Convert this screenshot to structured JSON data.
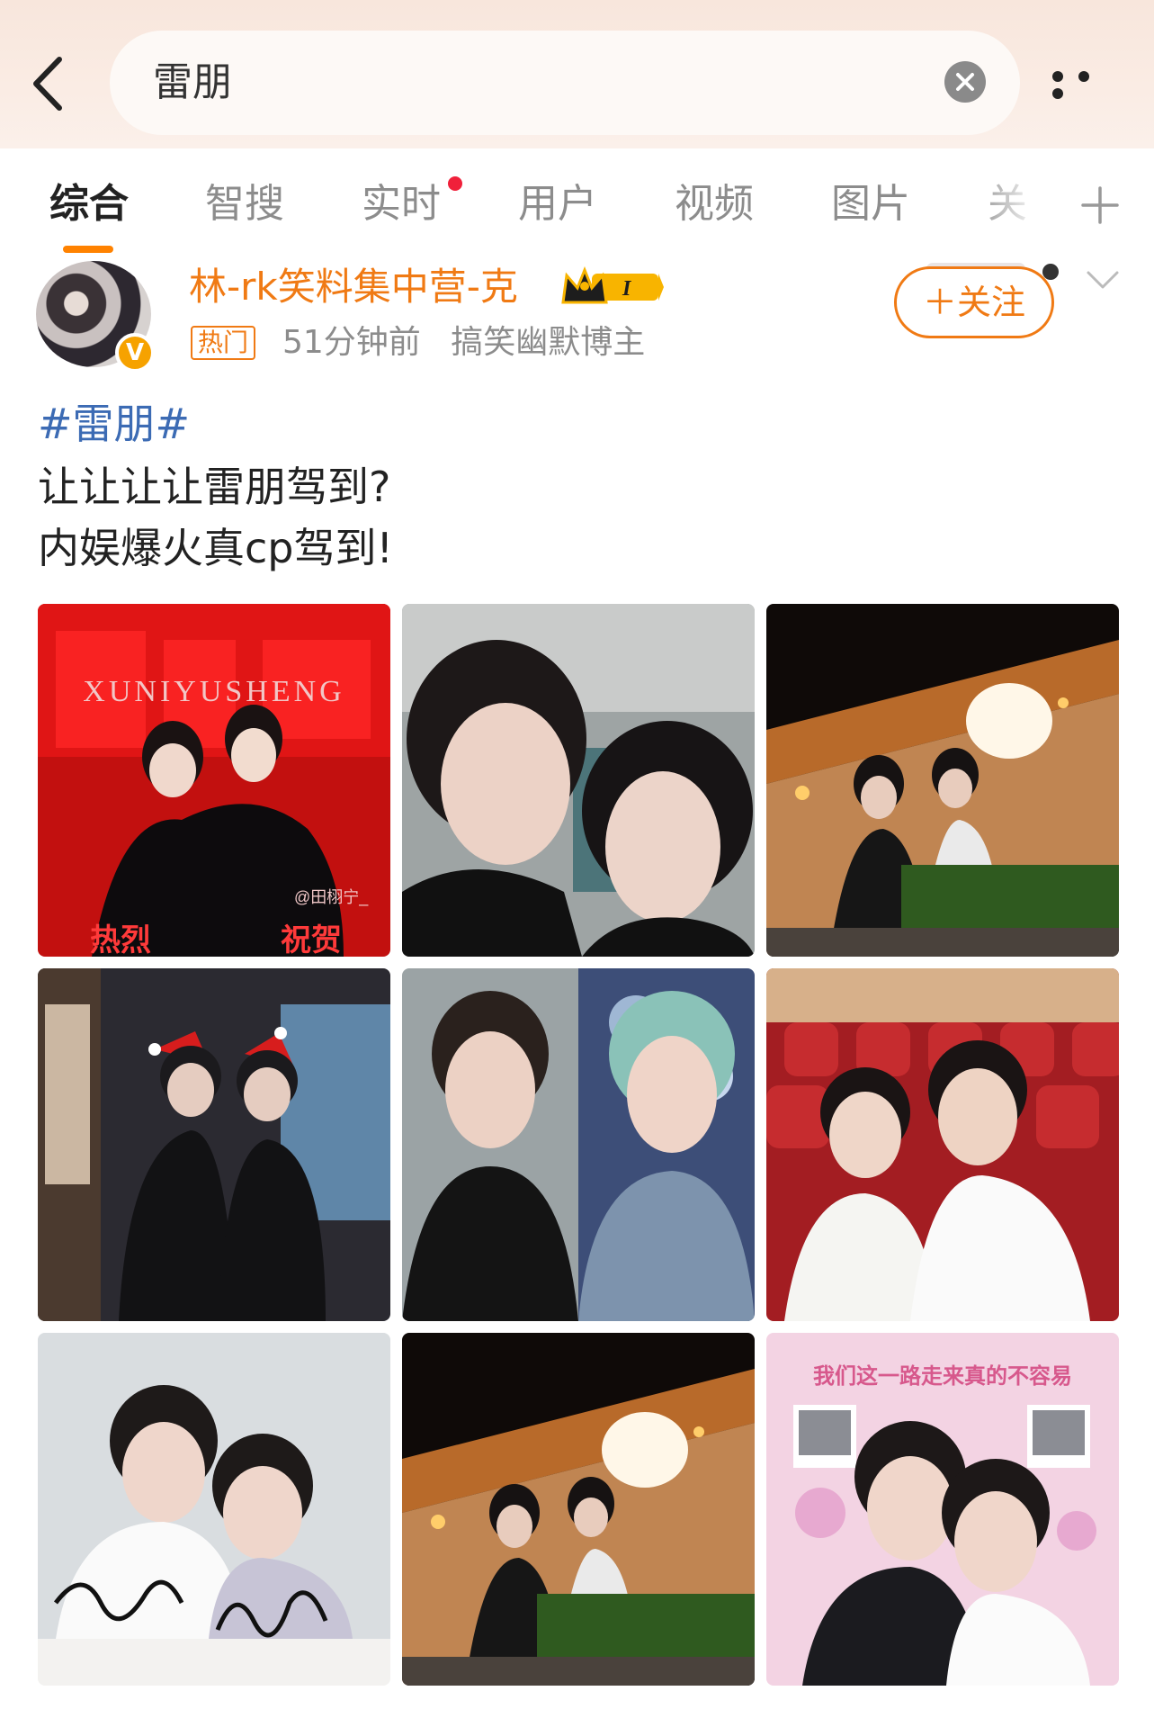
{
  "search": {
    "query": "雷朋"
  },
  "tabs": [
    {
      "label": "综合"
    },
    {
      "label": "智搜"
    },
    {
      "label": "实时"
    },
    {
      "label": "用户"
    },
    {
      "label": "视频"
    },
    {
      "label": "图片"
    },
    {
      "label": "关"
    }
  ],
  "post": {
    "author": "林-rk笑料集中营-克",
    "vip_level": "I",
    "verified_badge": "V",
    "hot_tag": "热门",
    "time": "51分钟前",
    "author_desc": "搞笑幽默博主",
    "follow_label": "＋关注",
    "hashtag": "#雷朋#",
    "lines": [
      "让让让让雷朋驾到?",
      "内娱爆火真cp驾到!"
    ],
    "images": [
      {
        "name": "photo-red-poster",
        "caption_top": "XUNIYUSHENG",
        "caption_bottom_left": "热烈",
        "caption_bottom_right": "祝贺",
        "watermark": "@田栩宁_"
      },
      {
        "name": "photo-closeup-selfie"
      },
      {
        "name": "photo-stage-balcony"
      },
      {
        "name": "photo-christmas-hats"
      },
      {
        "name": "photo-split-portrait"
      },
      {
        "name": "photo-cinema-seats"
      },
      {
        "name": "photo-signed-polaroid"
      },
      {
        "name": "photo-stage-balcony-2"
      },
      {
        "name": "photo-pink-collage",
        "caption_top": "我们这一路走来真的不容易"
      }
    ]
  },
  "colors": {
    "accent_orange": "#f07a14",
    "tab_indicator": "#ff8200",
    "hashtag_blue": "#3c6bb4",
    "notification_red": "#f0203a"
  },
  "icons": {
    "back": "chevron-left-icon",
    "clear": "close-circle-icon",
    "more": "more-horizontal-icon",
    "add_tab": "plus-icon",
    "dropdown": "chevron-down-icon",
    "vip": "crown-icon"
  }
}
